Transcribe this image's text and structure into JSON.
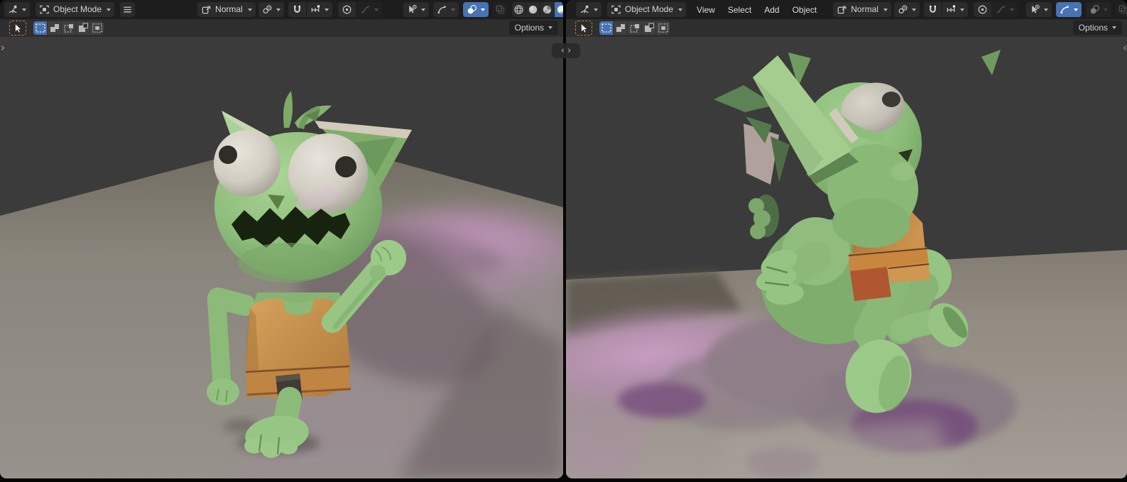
{
  "app_chrome": {
    "split_handle": {
      "left_glyph": "‹",
      "right_glyph": "›"
    },
    "region_toggle_open": "›",
    "region_toggle_close": "‹"
  },
  "colors": {
    "accent_blue": "#4772b3",
    "active_tool_outline": "#c77f3e",
    "header_bg": "#1d1d1d",
    "toolbar_bg": "#2e2e2e",
    "widget_bg": "#2b2b2b",
    "viewport_bg": "#3b3b3b",
    "window_bg": "#050505",
    "text": "#d6d6d6",
    "character_green": "#96c583",
    "character_green_dark": "#6f9c60",
    "vest_orange": "#c98f4c",
    "belt_red": "#b05732",
    "eye_white": "#d8d4cc",
    "ground_gray": "#95908a",
    "light_pink": "#c49ac0",
    "shadow_purple": "#76507b"
  },
  "icons": {
    "editor_type": "3d-viewport-icon",
    "mode": "object-mode-icon",
    "collapsed_menus": "hamburger-icon",
    "orientation": "transform-orientation-icon",
    "pivot": "pivot-point-icon",
    "snap": "magnet-icon",
    "snap_with": "snap-target-icon",
    "proportional": "proportional-editing-icon",
    "falloff": "falloff-curve-icon",
    "object_types": "eye-cursor-icon",
    "gizmos": "gizmo-arc-icon",
    "overlays": "overlays-circles-icon",
    "xray": "xray-squares-icon",
    "shading_wireframe": "wireframe-sphere-icon",
    "shading_solid": "solid-sphere-icon",
    "shading_material": "material-sphere-icon",
    "shading_rendered": "rendered-sphere-icon",
    "active_tool": "select-box-cursor-icon"
  },
  "viewports": {
    "left": {
      "header": {
        "mode_label": "Object Mode",
        "orientation_label": "Normal"
      },
      "toolbar": {
        "options_label": "Options"
      },
      "state": {
        "overlays_active": true,
        "gizmos_active": false,
        "shading_active": "rendered",
        "active_tool": "select-box",
        "select_mode_active": "set",
        "snapping_active": false,
        "menus_collapsed": true
      }
    },
    "right": {
      "header": {
        "mode_label": "Object Mode",
        "menus": [
          {
            "label": "View"
          },
          {
            "label": "Select"
          },
          {
            "label": "Add"
          },
          {
            "label": "Object"
          }
        ],
        "orientation_label": "Normal"
      },
      "toolbar": {
        "options_label": "Options"
      },
      "state": {
        "overlays_active": false,
        "gizmos_active": true,
        "active_tool": "select-box",
        "select_mode_active": "set",
        "snapping_active": false,
        "menus_collapsed": false
      }
    }
  }
}
